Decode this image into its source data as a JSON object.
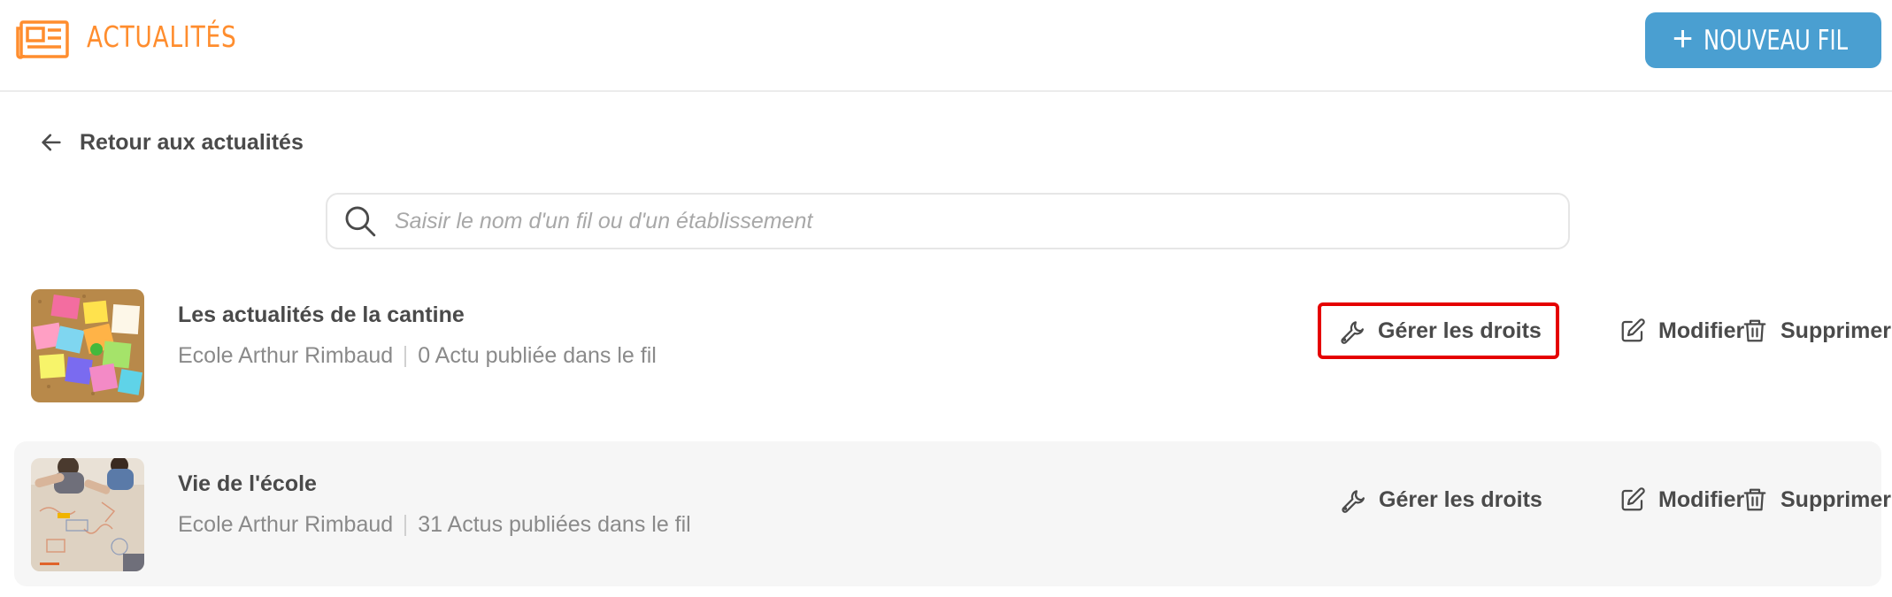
{
  "header": {
    "title": "ACTUALITÉS",
    "icon": "newspaper-icon",
    "accent_color": "#ff8d2e",
    "new_button": {
      "plus": "+",
      "label": "NOUVEAU FIL",
      "color": "#4a9fd1"
    }
  },
  "back": {
    "label": "Retour aux actualités",
    "icon": "arrow-left-icon"
  },
  "search": {
    "placeholder": "Saisir le nom d'un fil ou d'un établissement",
    "value": ""
  },
  "threads": [
    {
      "title": "Les actualités de la cantine",
      "school": "Ecole Arthur Rimbaud",
      "count_text": "0 Actu publiée dans le fil",
      "actions": {
        "rights": "Gérer les droits",
        "edit": "Modifier",
        "delete": "Supprimer"
      },
      "highlight_color": "#e50000"
    },
    {
      "title": "Vie de l'école",
      "school": "Ecole Arthur Rimbaud",
      "count_text": "31 Actus publiées dans le fil",
      "actions": {
        "rights": "Gérer les droits",
        "edit": "Modifier",
        "delete": "Supprimer"
      }
    }
  ]
}
